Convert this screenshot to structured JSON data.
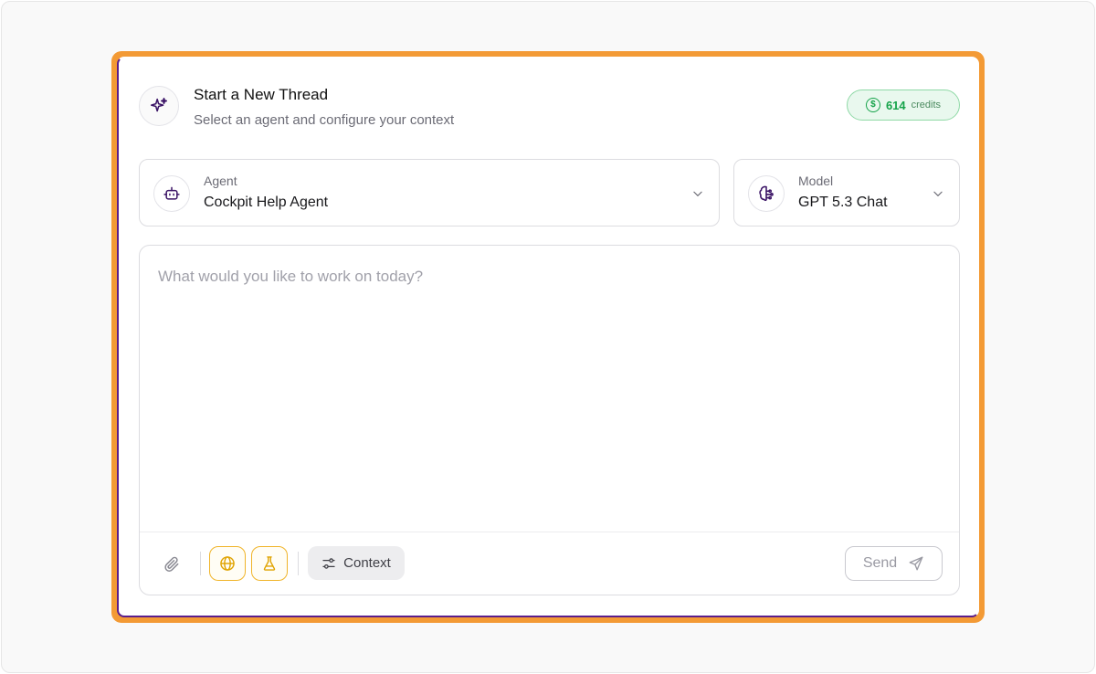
{
  "header": {
    "title": "Start a New Thread",
    "subtitle": "Select an agent and configure your context",
    "credits": {
      "amount": "614",
      "label": "credits",
      "coin_symbol": "$"
    }
  },
  "agent_selector": {
    "label": "Agent",
    "value": "Cockpit Help Agent",
    "icon": "robot-icon"
  },
  "model_selector": {
    "label": "Model",
    "value": "GPT 5.3 Chat",
    "icon": "brain-icon"
  },
  "composer": {
    "placeholder": "What would you like to work on today?",
    "value": "",
    "toolbar": {
      "attach_icon": "paperclip-icon",
      "web_toggle_icon": "globe-icon",
      "research_toggle_icon": "flask-icon",
      "context_label": "Context",
      "send_label": "Send"
    }
  },
  "colors": {
    "accent_highlight": "#f39a35",
    "credits_green": "#16a34a",
    "toggle_active": "#f0b429",
    "icon_purple": "#3b1466"
  }
}
